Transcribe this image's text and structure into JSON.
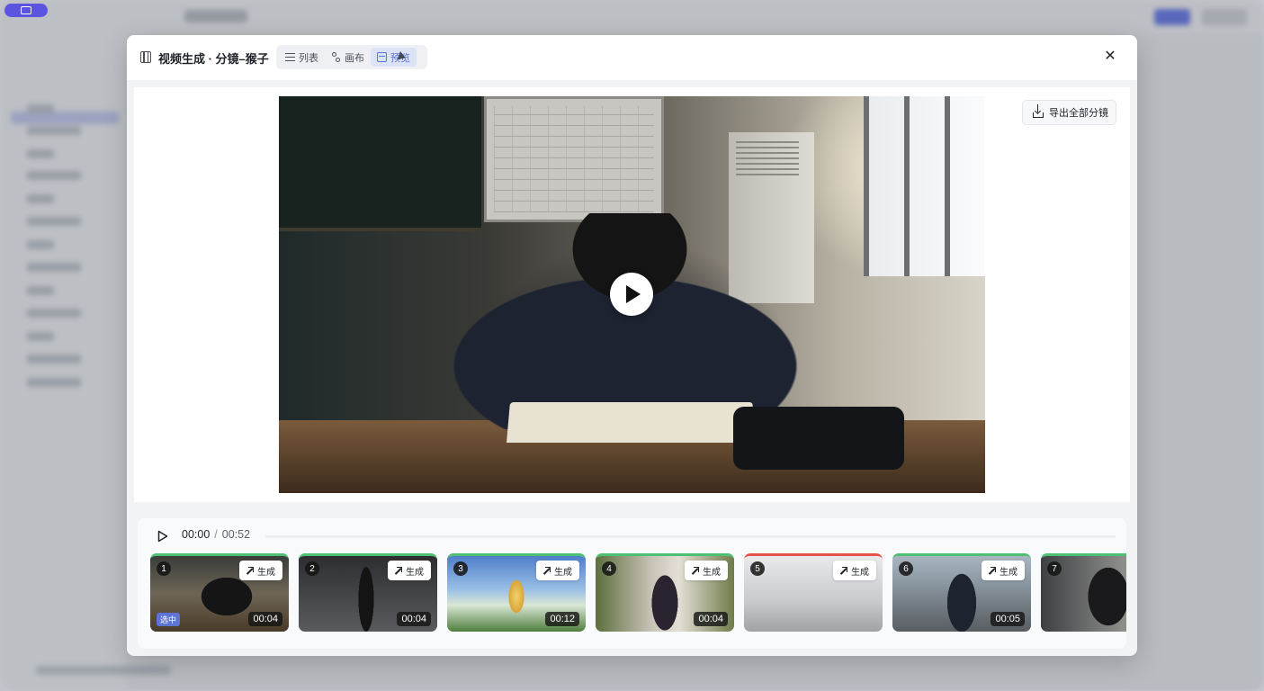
{
  "modal": {
    "title": "视频生成 · 分镜–猴子",
    "view_tabs": [
      {
        "label": "列表",
        "icon": "list-icon",
        "active": false
      },
      {
        "label": "画布",
        "icon": "canvas-icon",
        "active": false
      },
      {
        "label": "预览",
        "icon": "preview-icon",
        "active": true
      }
    ],
    "close_label": "✕"
  },
  "preview": {
    "export_label": "导出全部分镜"
  },
  "timeline": {
    "current_time": "00:00",
    "separator": "/",
    "total_time": "00:52",
    "progress": 0,
    "generate_label": "生成",
    "selected_label": "选中",
    "shots": [
      {
        "index": "1",
        "duration": "00:04",
        "status": "success",
        "selected": true
      },
      {
        "index": "2",
        "duration": "00:04",
        "status": "success",
        "selected": false
      },
      {
        "index": "3",
        "duration": "00:12",
        "status": "success",
        "selected": false
      },
      {
        "index": "4",
        "duration": "00:04",
        "status": "success",
        "selected": false
      },
      {
        "index": "5",
        "duration": "",
        "status": "error",
        "selected": false
      },
      {
        "index": "6",
        "duration": "00:05",
        "status": "success",
        "selected": false
      },
      {
        "index": "7",
        "duration": "",
        "status": "success",
        "selected": false
      }
    ]
  },
  "colors": {
    "accent": "#5b74d6",
    "success": "#4fbf73",
    "error": "#e5524b"
  }
}
